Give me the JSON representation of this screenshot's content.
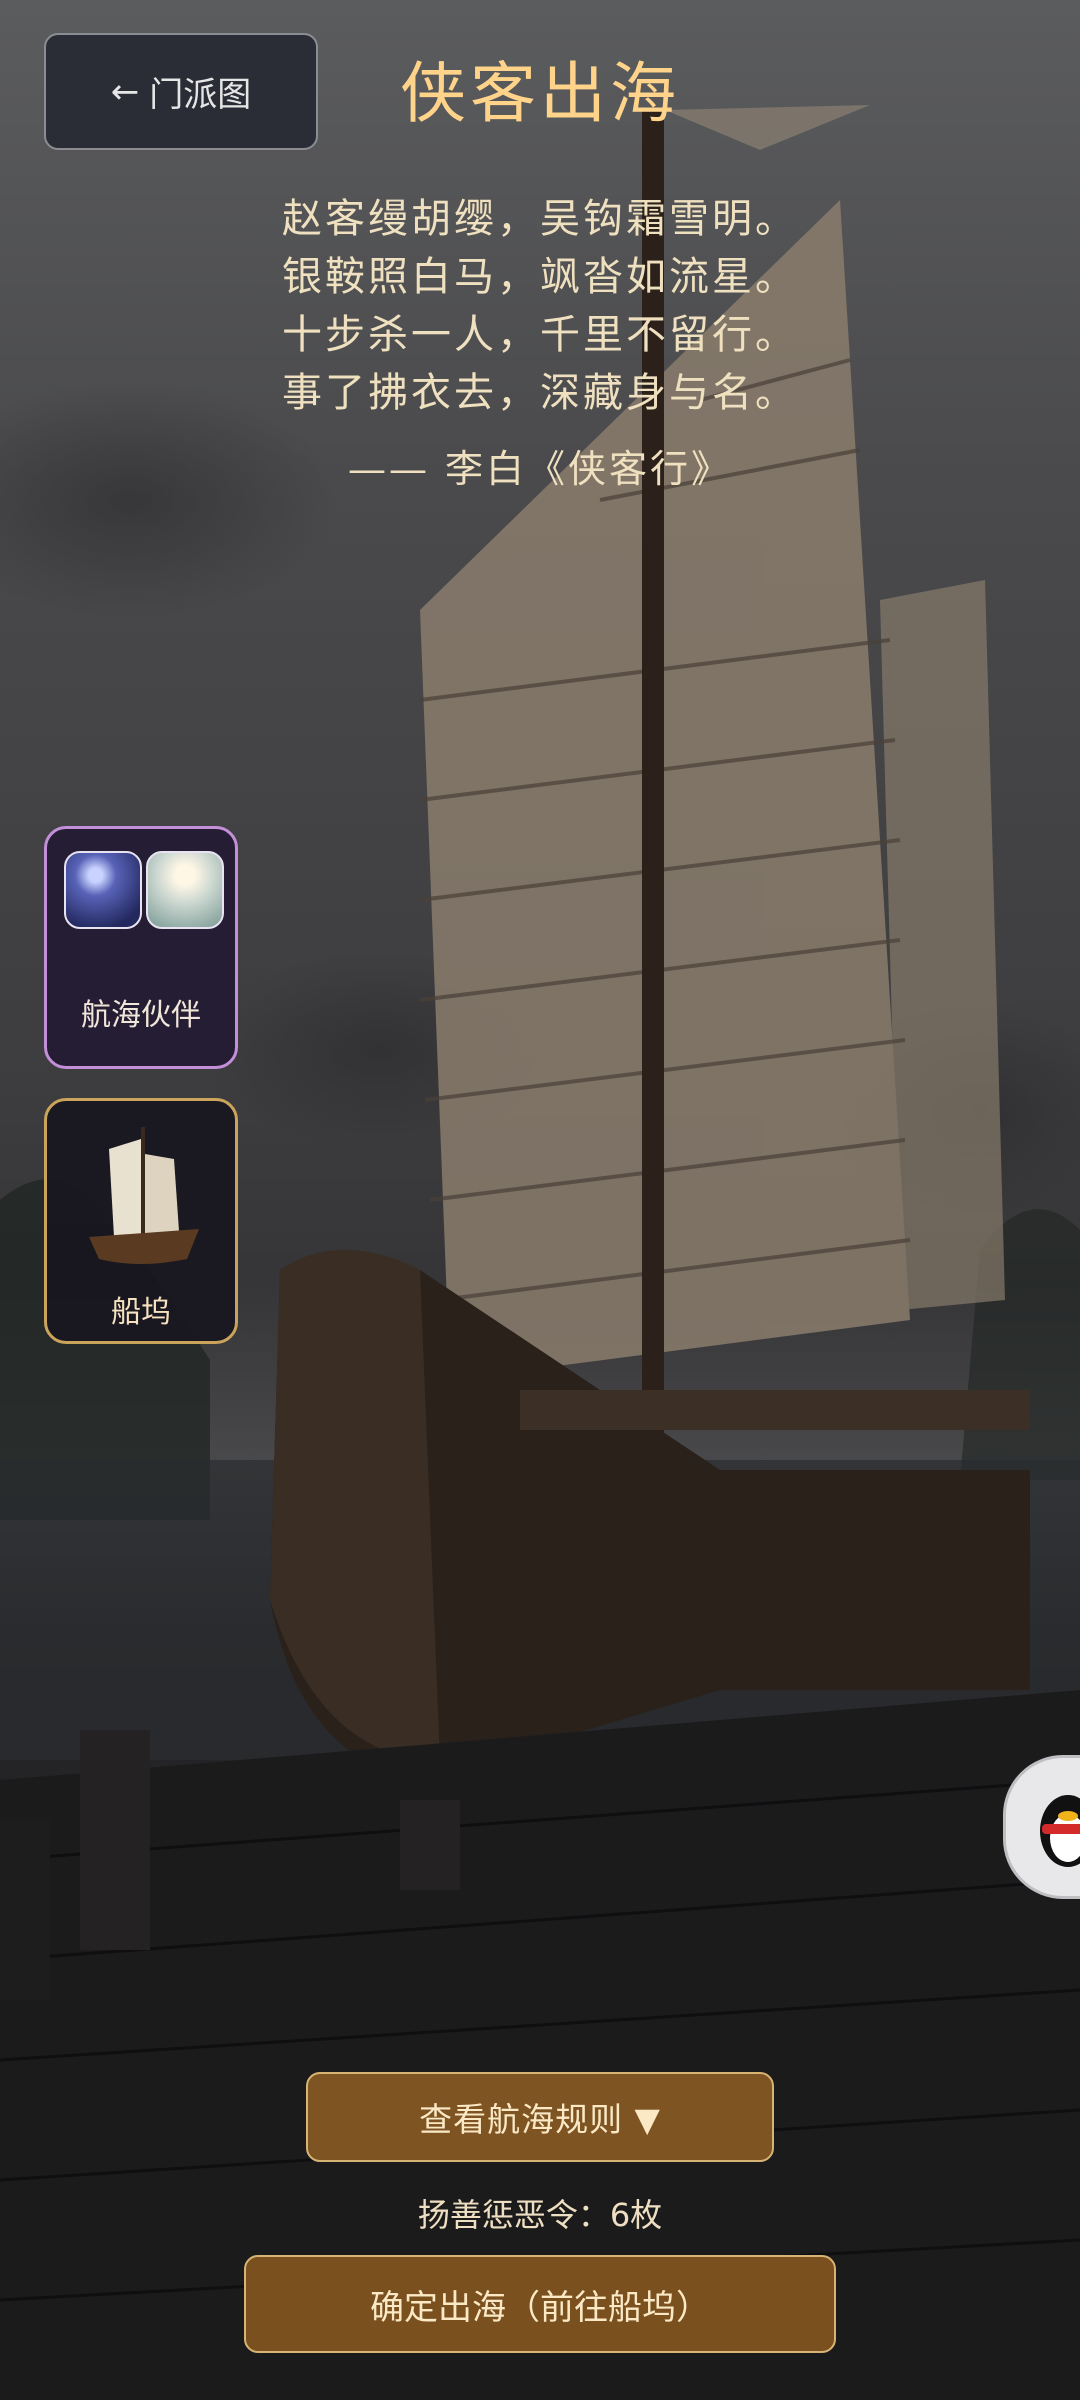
{
  "header": {
    "back_label": "门派图",
    "title": "侠客出海"
  },
  "poem": {
    "lines": [
      "赵客缦胡缨，吴钩霜雪明。",
      "银鞍照白马，飒沓如流星。",
      "十步杀一人，千里不留行。",
      "事了拂衣去，深藏身与名。"
    ],
    "author": "—— 李白《侠客行》"
  },
  "side_cards": {
    "partner_label": "航海伙伴",
    "dock_label": "船坞"
  },
  "actions": {
    "rules_label": "查看航海规则 ▼",
    "token_text": "扬善惩恶令：6枚",
    "confirm_label": "确定出海（前往船坞）"
  },
  "icons": {
    "back": "arrow-left-icon",
    "floating": "qq-penguin-icon"
  },
  "colors": {
    "title": "#ffd48a",
    "button_bg": "#7d5422",
    "button_border": "#d7b474",
    "partner_border": "#c38fd9",
    "dock_border": "#c9a45a"
  }
}
